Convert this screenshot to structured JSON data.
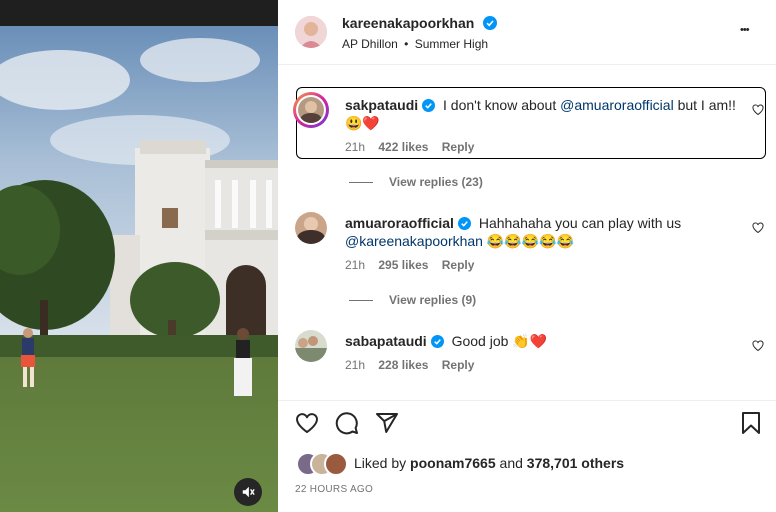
{
  "post": {
    "username": "kareenakapoorkhan",
    "audio": "AP Dhillon",
    "audio_sep": "•",
    "audio_track": "Summer High",
    "more_label": "•••"
  },
  "comments": [
    {
      "username": "sakpataudi",
      "text_before": "I don't know about ",
      "mention": "@amuaroraofficial",
      "text_after": " but I am!!",
      "emojis": "😃❤️",
      "time": "21h",
      "likes": "422 likes",
      "reply": "Reply",
      "view_replies": "View replies (23)"
    },
    {
      "username": "amuaroraofficial",
      "text_before": "Hahhahaha you can play with us",
      "mention": "@kareenakapoorkhan",
      "emojis": "😂😂😂😂😂",
      "time": "21h",
      "likes": "295 likes",
      "reply": "Reply",
      "view_replies": "View replies (9)"
    },
    {
      "username": "sabapataudi",
      "text_before": "Good job ",
      "emojis": "👏❤️",
      "time": "21h",
      "likes": "228 likes",
      "reply": "Reply"
    }
  ],
  "likes_summary": {
    "prefix": "Liked by ",
    "user": "poonam7665",
    "middle": " and ",
    "others": "378,701 others"
  },
  "timestamp": "22 HOURS AGO",
  "icons": {
    "like": "heart-icon",
    "comment": "comment-icon",
    "share": "share-icon",
    "save": "bookmark-icon",
    "mute": "muted-speaker-icon",
    "verified": "verified-badge-icon"
  },
  "colors": {
    "verified": "#0095f6",
    "mention": "#00376b",
    "text": "#262626",
    "muted": "#737373"
  }
}
